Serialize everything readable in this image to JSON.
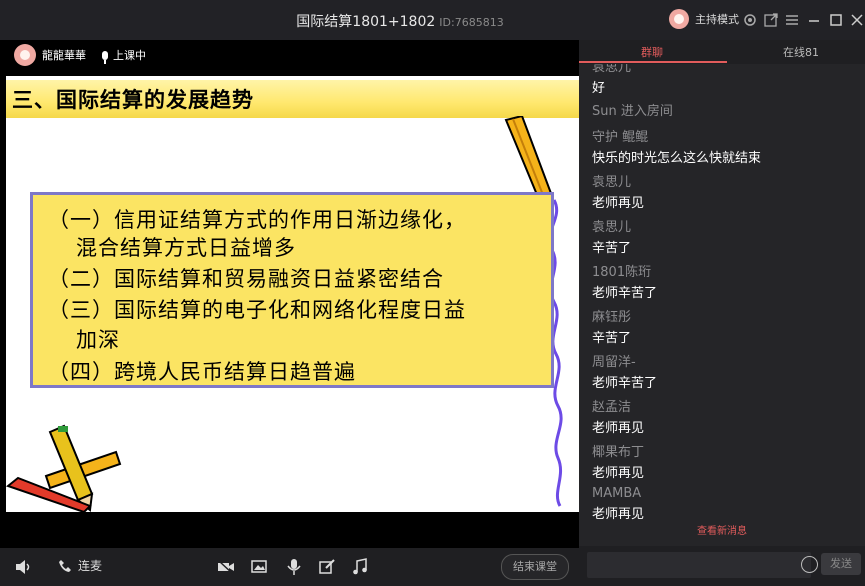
{
  "window": {
    "title": "国际结算1801+1802",
    "room_id": "ID:7685813",
    "host_mode": "主持模式"
  },
  "stage": {
    "user_name": "龍龍華華",
    "status": "上课中"
  },
  "slide": {
    "title": "三、国际结算的发展趋势",
    "lines": [
      "（一）信用证结算方式的作用日渐边缘化，",
      "混合结算方式日益增多",
      "（二）国际结算和贸易融资日益紧密结合",
      "（三）国际结算的电子化和网络化程度日益",
      "加深",
      "（四）跨境人民币结算日趋普遍"
    ]
  },
  "controls": {
    "lianmai": "连麦",
    "end_class": "结束课堂"
  },
  "chat": {
    "tabs": [
      "群聊",
      "在线81"
    ],
    "partial_sender": "袁思儿",
    "first_text": "好",
    "system_message": "Sun 进入房间",
    "messages": [
      {
        "sender": "守护 鲲鲲",
        "text": "快乐的时光怎么这么快就结束"
      },
      {
        "sender": "袁思儿",
        "text": "老师再见"
      },
      {
        "sender": "袁思儿",
        "text": "辛苦了"
      },
      {
        "sender": "1801陈珩",
        "text": "老师辛苦了"
      },
      {
        "sender": "麻钰彤",
        "text": "辛苦了"
      },
      {
        "sender": "周留洋-",
        "text": "老师辛苦了"
      },
      {
        "sender": "赵孟洁",
        "text": "老师再见"
      },
      {
        "sender": "椰果布丁",
        "text": "老师再见"
      },
      {
        "sender": "MAMBA",
        "text": "老师再见"
      }
    ],
    "new_messages": "查看新消息",
    "input_placeholder": "",
    "send_label": "发送"
  },
  "colors": {
    "accent": "#e25c5c",
    "slide_box": "#fbe463",
    "slide_box_border": "#7e78c8"
  }
}
